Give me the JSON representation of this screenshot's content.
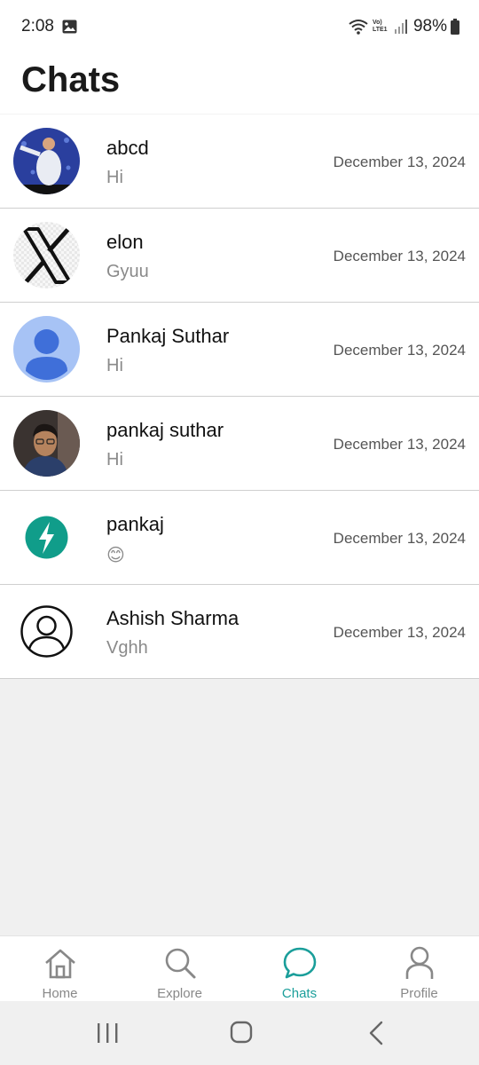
{
  "status_bar": {
    "time": "2:08",
    "network_label": "Vo) LTE1",
    "battery": "98%"
  },
  "header": {
    "title": "Chats"
  },
  "chats": [
    {
      "name": "abcd",
      "message": "Hi",
      "date": "December 13, 2024",
      "avatar": "photo-avatar"
    },
    {
      "name": "elon",
      "message": "Gyuu",
      "date": "December 13, 2024",
      "avatar": "x-logo-avatar"
    },
    {
      "name": "Pankaj Suthar",
      "message": "Hi",
      "date": "December 13, 2024",
      "avatar": "default-person-avatar"
    },
    {
      "name": "pankaj suthar",
      "message": "Hi",
      "date": "December 13, 2024",
      "avatar": "photo-avatar"
    },
    {
      "name": "pankaj",
      "message": "😊",
      "date": "December 13, 2024",
      "avatar": "lightning-logo-avatar"
    },
    {
      "name": "Ashish Sharma",
      "message": "Vghh",
      "date": "December 13, 2024",
      "avatar": "outline-person-avatar"
    }
  ],
  "bottom_nav": {
    "items": [
      {
        "label": "Home",
        "icon": "home-icon",
        "active": false
      },
      {
        "label": "Explore",
        "icon": "search-icon",
        "active": false
      },
      {
        "label": "Chats",
        "icon": "chat-bubble-icon",
        "active": true
      },
      {
        "label": "Profile",
        "icon": "person-icon",
        "active": false
      }
    ]
  },
  "colors": {
    "accent": "#1a9e9a",
    "inactive": "#888888",
    "divider": "#cfcfcf",
    "background": "#f0f0f0"
  }
}
